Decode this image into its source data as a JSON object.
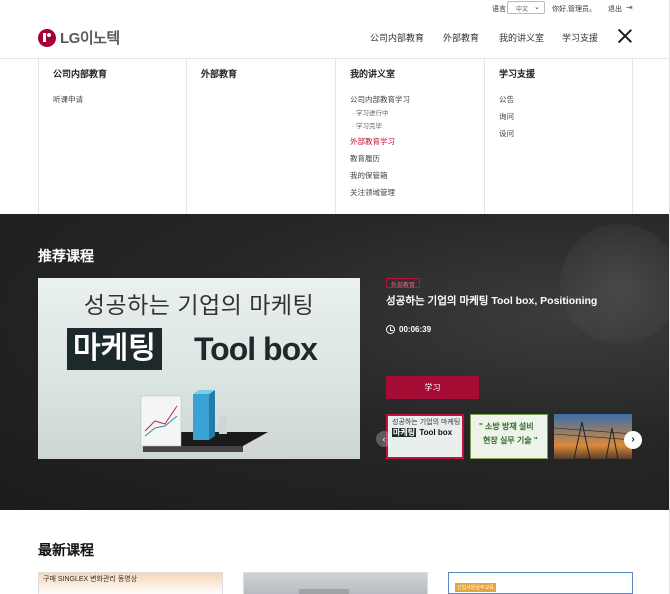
{
  "util": {
    "lang_label": "语言",
    "lang_value": "中文",
    "greeting": "你好,管理员。",
    "logout": "退出"
  },
  "header": {
    "logo_text": "LG이노텍",
    "nav": [
      "公司内部教育",
      "外部教育",
      "我的讲义室",
      "学习支援"
    ]
  },
  "mega": {
    "col1": {
      "title": "公司内部教育",
      "items": [
        "听课申请"
      ]
    },
    "col2": {
      "title": "外部教育",
      "items": []
    },
    "col3": {
      "title": "我的讲义室",
      "item1": "公司内部教育学习",
      "sub1": "· 学习进行中",
      "sub2": "· 学习完毕",
      "item2": "外部教育学习",
      "item3": "教育履历",
      "item4": "我的保管箱",
      "item5": "关注领域管理"
    },
    "col4": {
      "title": "学习支援",
      "items": [
        "公告",
        "询问",
        "设问"
      ]
    }
  },
  "hero": {
    "title": "推荐课程",
    "thumb_line1": "성공하는 기업의 마케팅",
    "thumb_word_dark": "마케팅",
    "thumb_word_light": "Tool box",
    "tag": "外部教育",
    "course_title": "성공하는 기업의 마케팅 Tool box, Positioning",
    "duration": "00:06:39",
    "study_button": "学习",
    "thumb1_line1": "성공하는 기업의 마케팅",
    "thumb1_dark": "마케팅",
    "thumb1_light": "Tool box",
    "thumb2_line1": "\" 소방 방재 설비",
    "thumb2_line2": "현장 실무 기술 \""
  },
  "latest": {
    "title": "最新课程",
    "card1_text": "구매 SINGLEX 변화관리 동영상",
    "card3_text": "신입사원실무교육"
  },
  "colors": {
    "brand": "#a50034",
    "accent_red": "#c0103b",
    "hero_bg": "#1c1c1c"
  }
}
